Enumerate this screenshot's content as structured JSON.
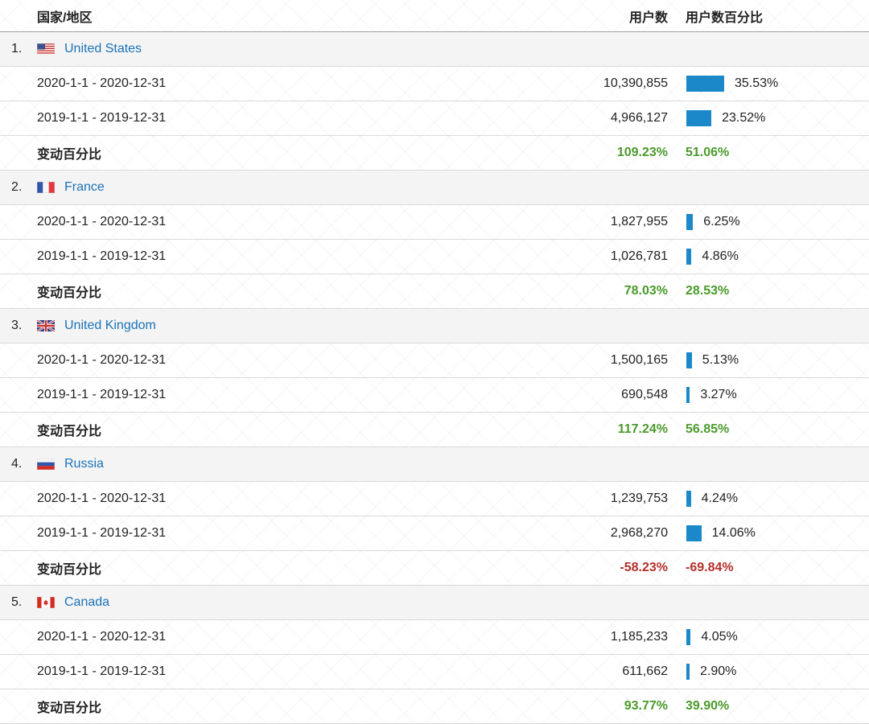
{
  "header": {
    "country_label": "国家/地区",
    "users_label": "用户数",
    "users_pct_label": "用户数百分比"
  },
  "rows": [
    {
      "rank": "1.",
      "country": "United States",
      "flag": "us-flag-icon",
      "current": {
        "range": "2020-1-1 - 2020-12-31",
        "users": "10,390,855",
        "pct": "35.53%",
        "pct_value": 35.53
      },
      "previous": {
        "range": "2019-1-1 - 2019-12-31",
        "users": "4,966,127",
        "pct": "23.52%",
        "pct_value": 23.52
      },
      "change": {
        "label": "变动百分比",
        "users": "109.23%",
        "pct": "51.06%",
        "positive": true
      }
    },
    {
      "rank": "2.",
      "country": "France",
      "flag": "fr-flag-icon",
      "current": {
        "range": "2020-1-1 - 2020-12-31",
        "users": "1,827,955",
        "pct": "6.25%",
        "pct_value": 6.25
      },
      "previous": {
        "range": "2019-1-1 - 2019-12-31",
        "users": "1,026,781",
        "pct": "4.86%",
        "pct_value": 4.86
      },
      "change": {
        "label": "变动百分比",
        "users": "78.03%",
        "pct": "28.53%",
        "positive": true
      }
    },
    {
      "rank": "3.",
      "country": "United Kingdom",
      "flag": "uk-flag-icon",
      "current": {
        "range": "2020-1-1 - 2020-12-31",
        "users": "1,500,165",
        "pct": "5.13%",
        "pct_value": 5.13
      },
      "previous": {
        "range": "2019-1-1 - 2019-12-31",
        "users": "690,548",
        "pct": "3.27%",
        "pct_value": 3.27
      },
      "change": {
        "label": "变动百分比",
        "users": "117.24%",
        "pct": "56.85%",
        "positive": true
      }
    },
    {
      "rank": "4.",
      "country": "Russia",
      "flag": "ru-flag-icon",
      "current": {
        "range": "2020-1-1 - 2020-12-31",
        "users": "1,239,753",
        "pct": "4.24%",
        "pct_value": 4.24
      },
      "previous": {
        "range": "2019-1-1 - 2019-12-31",
        "users": "2,968,270",
        "pct": "14.06%",
        "pct_value": 14.06
      },
      "change": {
        "label": "变动百分比",
        "users": "-58.23%",
        "pct": "-69.84%",
        "positive": false
      }
    },
    {
      "rank": "5.",
      "country": "Canada",
      "flag": "ca-flag-icon",
      "current": {
        "range": "2020-1-1 - 2020-12-31",
        "users": "1,185,233",
        "pct": "4.05%",
        "pct_value": 4.05
      },
      "previous": {
        "range": "2019-1-1 - 2019-12-31",
        "users": "611,662",
        "pct": "2.90%",
        "pct_value": 2.9
      },
      "change": {
        "label": "变动百分比",
        "users": "93.77%",
        "pct": "39.90%",
        "positive": true
      }
    }
  ],
  "colors": {
    "link": "#1a73b8",
    "bar": "#1a88c9",
    "positive": "#4b9a2b",
    "negative": "#b3302a"
  }
}
